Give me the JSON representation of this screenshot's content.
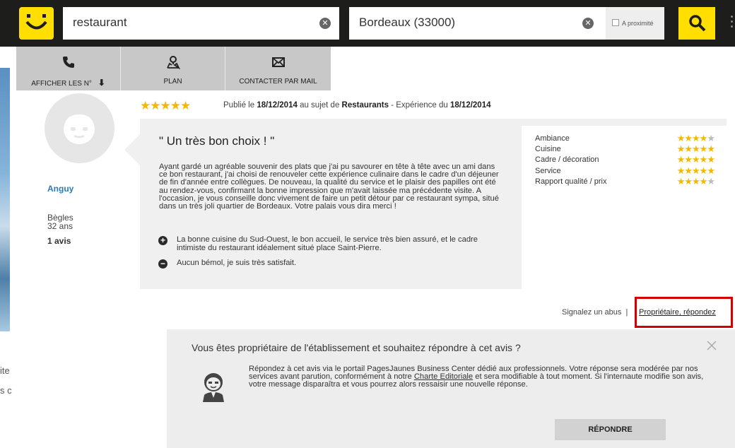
{
  "search": {
    "what_value": "restaurant",
    "where_value": "Bordeaux (33000)",
    "proximity_label": "A proximité"
  },
  "actions": {
    "phone_label": "AFFICHER LES N°",
    "map_label": "PLAN",
    "mail_label": "CONTACTER PAR MAIL"
  },
  "left_fragments": [
    "ite",
    "s c"
  ],
  "user": {
    "name": "Anguy",
    "city": "Bègles",
    "age": "32 ans",
    "review_count": "1 avis"
  },
  "review": {
    "stars": 5,
    "published_prefix": "Publié le ",
    "published_date": "18/12/2014",
    "subject_prefix": " au sujet de ",
    "subject": "Restaurants",
    "experience_prefix": " - Expérience du ",
    "experience_date": "18/12/2014",
    "title": "\" Un très bon choix ! \"",
    "body": "Ayant gardé un agréable souvenir des plats que j'ai pu savourer en tête à tête avec un ami dans ce bon restaurant, j'ai choisi de renouveler cette expérience culinaire dans le cadre d'un déjeuner de fin d'année entre collègues. De nouveau, la qualité du service et le plaisir des papilles ont été au rendez-vous, confirmant la bonne impression que m'avait laissée ma précédente visite. A l'occasion, je vous conseille donc vivement de faire un petit détour par ce restaurant sympa, situé dans un très joli quartier de Bordeaux. Votre palais vous dira merci !",
    "positive": "La bonne cuisine du Sud-Ouest, le bon accueil, le service très bien assuré, et le cadre intimiste du restaurant idéalement situé place Saint-Pierre.",
    "negative": "Aucun bémol, je suis très satisfait.",
    "ratings": [
      {
        "label": "Ambiance",
        "stars": 4
      },
      {
        "label": "Cuisine",
        "stars": 5
      },
      {
        "label": "Cadre / décoration",
        "stars": 5
      },
      {
        "label": "Service",
        "stars": 5
      },
      {
        "label": "Rapport qualité / prix",
        "stars": 4
      }
    ]
  },
  "report": {
    "abuse_label": "Signalez un abus",
    "separator": "|",
    "owner_reply_label": "Propriétaire, répondez"
  },
  "owner_panel": {
    "title": "Vous êtes propriétaire de l'établissement et souhaitez répondre à cet avis ?",
    "text_before_link": "Répondez à cet avis via le portail PagesJaunes Business Center dédié aux professionnels. Votre réponse sera modérée par nos services avant parution, conformément à notre ",
    "link_label": "Charte Editoriale",
    "text_after_link": " et sera modifiable à tout moment. Si l'internaute modifie son avis, votre message disparaîtra et vous pourrez alors ressaisir une nouvelle réponse.",
    "reply_button": "RÉPONDRE"
  },
  "colors": {
    "brand_yellow": "#ffde00",
    "topbar": "#1d1d1b",
    "star": "#f5b800",
    "highlight_red": "#d40000",
    "user_link": "#2b7bb9"
  }
}
